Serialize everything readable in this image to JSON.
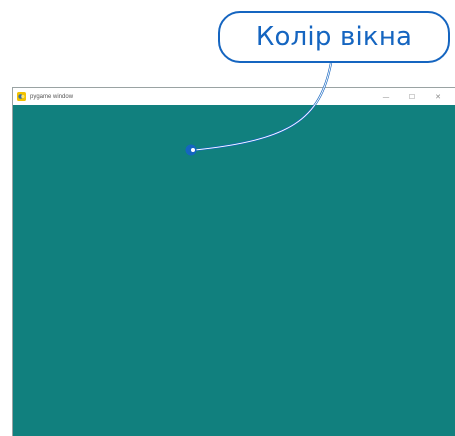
{
  "callout": {
    "label": "Колір вікна"
  },
  "window": {
    "title": "pygame window",
    "controls": {
      "minimize_glyph": "—",
      "maximize_glyph": "☐",
      "close_glyph": "✕"
    },
    "canvas_color": "#11807e"
  },
  "colors": {
    "accent": "#1565c0",
    "canvas": "#11807e",
    "titlebar": "#ffffff"
  },
  "icons": {
    "app": "pygame-snake-icon",
    "minimize": "minimize-icon",
    "maximize": "maximize-icon",
    "close": "close-icon"
  }
}
